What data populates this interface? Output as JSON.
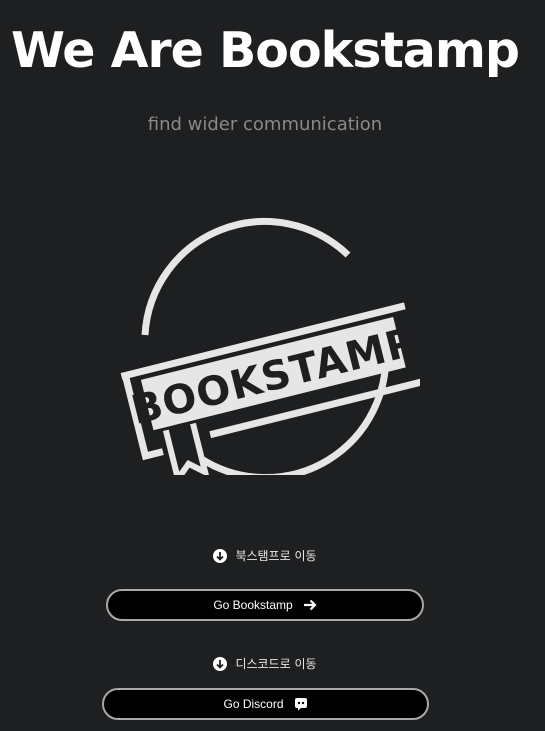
{
  "hero": {
    "title": "We Are Bookstamp",
    "tagline": "find wider communication"
  },
  "logo": {
    "text": "BOOKSTAMP",
    "icon": "bookstamp-logo"
  },
  "links": [
    {
      "section_label": "북스탬프로 이동",
      "section_icon": "arrow-down-circle-icon",
      "button_label": "Go Bookstamp",
      "button_icon": "arrow-right-icon"
    },
    {
      "section_label": "디스코드로 이동",
      "section_icon": "arrow-down-circle-icon",
      "button_label": "Go Discord",
      "button_icon": "discord-icon"
    }
  ],
  "colors": {
    "background": "#1e1f21",
    "text": "#ffffff",
    "tagline": "#8a8a8a",
    "logo": "#e6e6e6",
    "button_bg": "#000000",
    "button_border": "#a9a9a9"
  }
}
